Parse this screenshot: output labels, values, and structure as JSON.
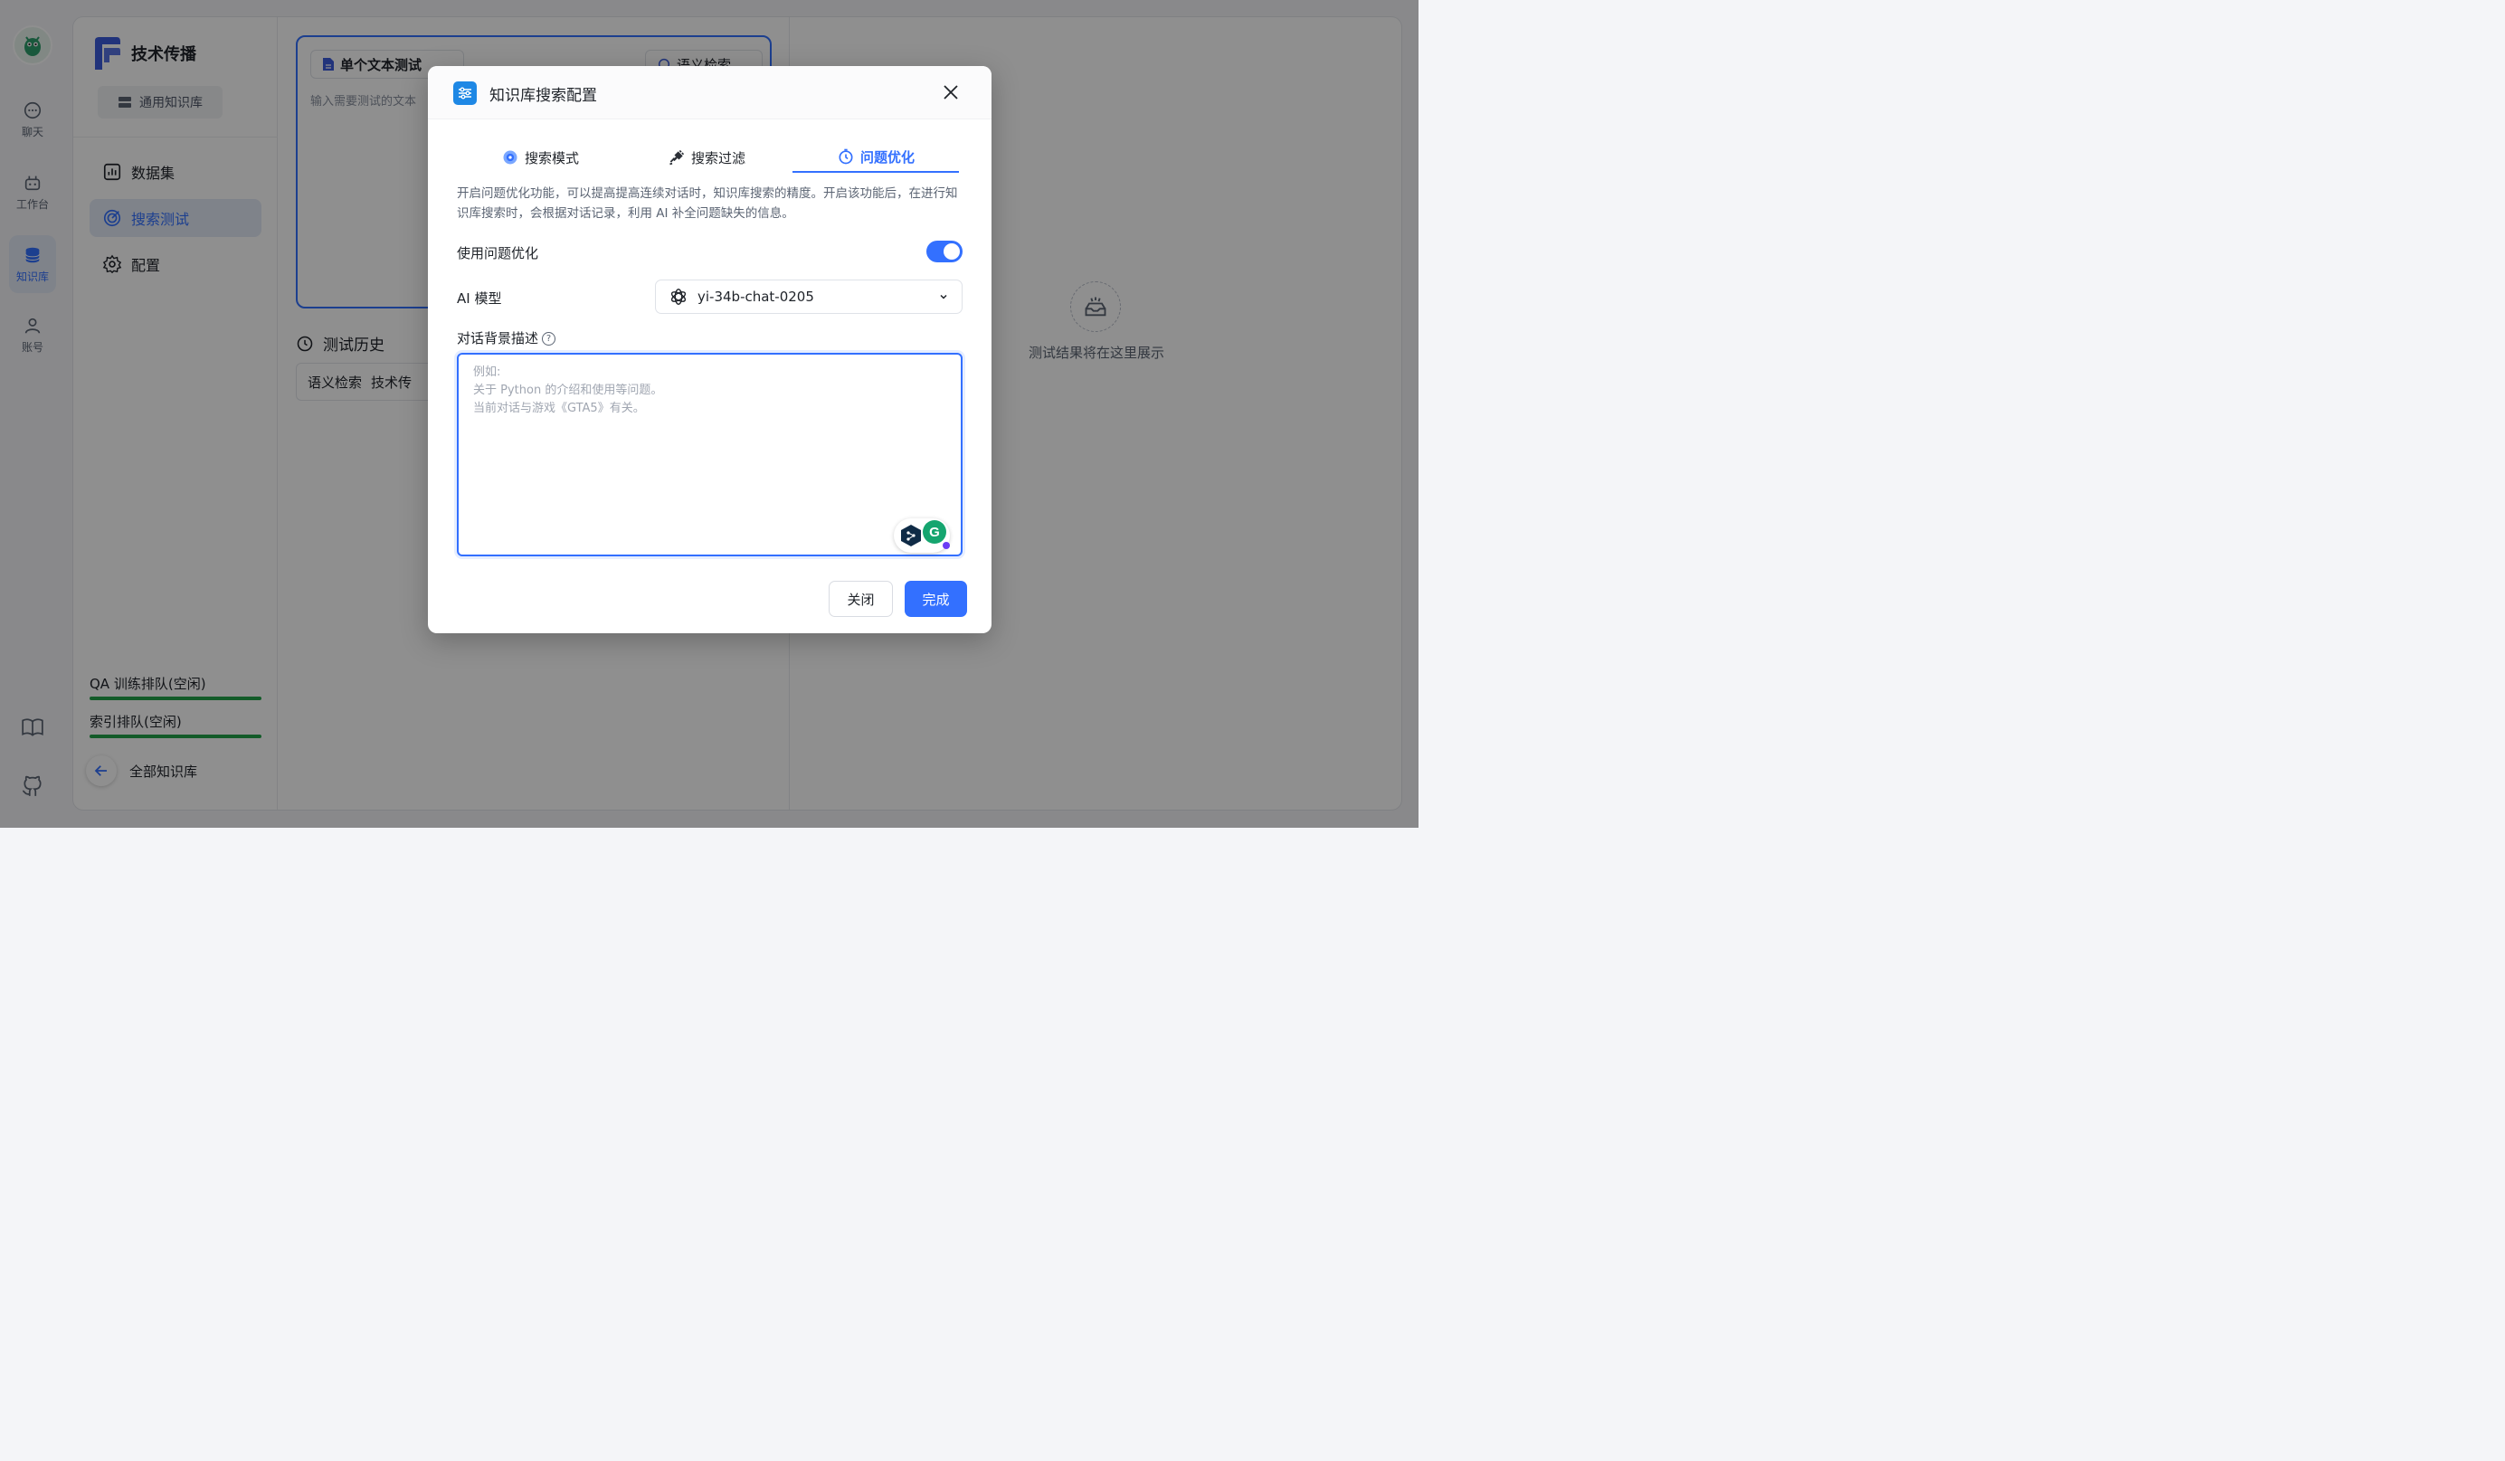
{
  "nav": {
    "items": [
      {
        "label": "聊天",
        "icon": "chat-icon"
      },
      {
        "label": "工作台",
        "icon": "robot-icon"
      },
      {
        "label": "知识库",
        "icon": "database-icon"
      },
      {
        "label": "账号",
        "icon": "user-icon"
      }
    ],
    "bottom_icons": [
      "book-icon",
      "github-icon"
    ]
  },
  "sidebar": {
    "kb_name": "技术传播",
    "kb_type": "通用知识库",
    "menu": [
      {
        "label": "数据集",
        "icon": "chart-icon"
      },
      {
        "label": "搜索测试",
        "icon": "target-icon"
      },
      {
        "label": "配置",
        "icon": "gear-icon"
      }
    ],
    "queues": [
      {
        "label": "QA 训练排队(空闲)",
        "progress": 1.0
      },
      {
        "label": "索引排队(空闲)",
        "progress": 1.0
      }
    ],
    "back_label": "全部知识库"
  },
  "test": {
    "mode_label": "单个文本测试",
    "search_chip": "语义检索",
    "input_placeholder": "输入需要测试的文本",
    "history_title": "测试历史",
    "history_row": {
      "mode": "语义检索",
      "text": "技术传"
    }
  },
  "result": {
    "empty_text": "测试结果将在这里展示"
  },
  "modal": {
    "title": "知识库搜索配置",
    "tabs": [
      {
        "label": "搜索模式",
        "icon": "gear-flower-icon",
        "active": false
      },
      {
        "label": "搜索过滤",
        "icon": "plug-icon",
        "active": false
      },
      {
        "label": "问题优化",
        "icon": "timer-icon",
        "active": true
      }
    ],
    "description": "开启问题优化功能，可以提高提高连续对话时，知识库搜索的精度。开启该功能后，在进行知识库搜索时，会根据对话记录，利用 AI 补全问题缺失的信息。",
    "use_optimize_label": "使用问题优化",
    "use_optimize_on": true,
    "model_label": "AI 模型",
    "model_value": "yi-34b-chat-0205",
    "bg_label": "对话背景描述",
    "bg_help": "?",
    "bg_placeholder": "例如:\n关于 Python 的介绍和使用等问题。\n当前对话与游戏《GTA5》有关。",
    "bg_value": "",
    "close_label": "关闭",
    "done_label": "完成"
  },
  "colors": {
    "accent": "#3370ff",
    "progress": "#22a34a",
    "modal_icon": "#1e88e5"
  }
}
